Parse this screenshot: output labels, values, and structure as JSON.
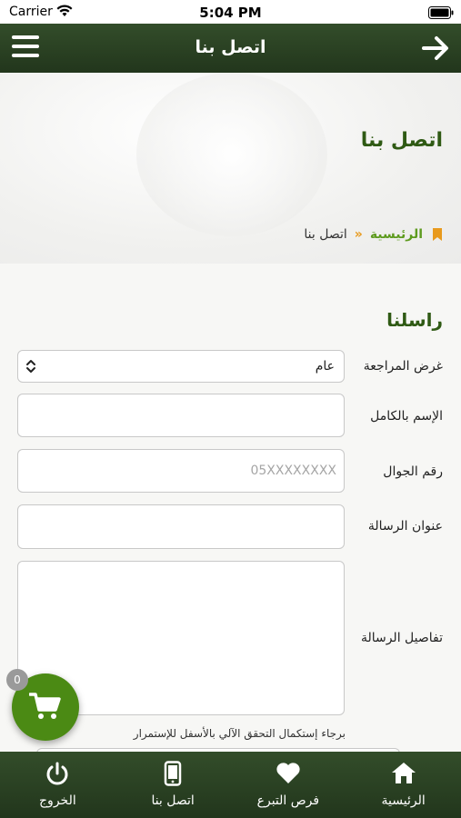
{
  "status_bar": {
    "carrier": "Carrier",
    "time": "5:04 PM"
  },
  "header": {
    "title": "اتصل بنا",
    "menu_icon": "hamburger-menu-icon",
    "back_icon": "arrow-right-icon"
  },
  "hero": {
    "heading": "اتصل بنا"
  },
  "breadcrumb": {
    "home": "الرئيسية",
    "separator": "»",
    "current": "اتصل بنا"
  },
  "form": {
    "section_title": "راسلنا",
    "purpose": {
      "label": "غرض المراجعة",
      "value": "عام"
    },
    "full_name": {
      "label": "الإسم بالكامل",
      "value": ""
    },
    "mobile": {
      "label": "رقم الجوال",
      "placeholder": "05XXXXXXXX"
    },
    "subject": {
      "label": "عنوان الرسالة",
      "value": ""
    },
    "details": {
      "label": "تفاصيل الرسالة",
      "value": ""
    },
    "captcha_note": "برجاء إستكمال التحقق الآلي بالأسفل للإستمرار"
  },
  "cart": {
    "count": "0"
  },
  "bottom_nav": [
    {
      "label": "الرئيسية",
      "icon": "home-icon"
    },
    {
      "label": "فرص التبرع",
      "icon": "heart-icon"
    },
    {
      "label": "اتصل بنا",
      "icon": "mobile-phone-icon"
    },
    {
      "label": "الخروج",
      "icon": "power-icon"
    }
  ],
  "colors": {
    "header_bg": "#2c4423",
    "accent_green": "#4b8a14",
    "heading_green": "#2f5a14",
    "breadcrumb_orange": "#e89a1d"
  }
}
